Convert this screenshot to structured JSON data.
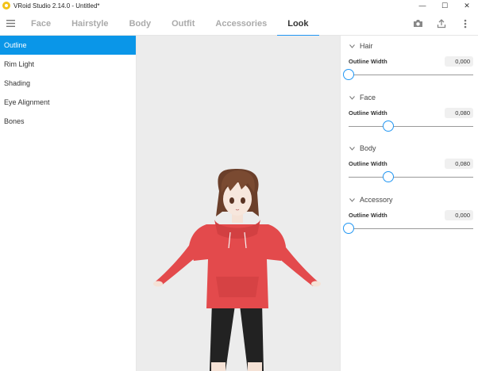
{
  "window": {
    "title": "VRoid Studio 2.14.0 - Untitled*",
    "controls": [
      "—",
      "☐",
      "✕"
    ]
  },
  "nav": {
    "menu_icon": "hamburger-icon",
    "tabs": [
      {
        "label": "Face",
        "active": false
      },
      {
        "label": "Hairstyle",
        "active": false
      },
      {
        "label": "Body",
        "active": false
      },
      {
        "label": "Outfit",
        "active": false
      },
      {
        "label": "Accessories",
        "active": false
      },
      {
        "label": "Look",
        "active": true
      }
    ],
    "accent_color": "#2196f3",
    "actions": [
      "camera-icon",
      "export-icon",
      "more-vert-icon"
    ]
  },
  "sidebar": {
    "items": [
      {
        "label": "Outline",
        "active": true
      },
      {
        "label": "Rim Light",
        "active": false
      },
      {
        "label": "Shading",
        "active": false
      },
      {
        "label": "Eye Alignment",
        "active": false
      },
      {
        "label": "Bones",
        "active": false
      }
    ],
    "active_color": "#0a96e8"
  },
  "panel": {
    "sections": [
      {
        "title": "Hair",
        "prop_label": "Outline Width",
        "value": "0,000",
        "fraction": 0.0
      },
      {
        "title": "Face",
        "prop_label": "Outline Width",
        "value": "0,080",
        "fraction": 0.32
      },
      {
        "title": "Body",
        "prop_label": "Outline Width",
        "value": "0,080",
        "fraction": 0.32
      },
      {
        "title": "Accessory",
        "prop_label": "Outline Width",
        "value": "0,000",
        "fraction": 0.0
      }
    ]
  }
}
